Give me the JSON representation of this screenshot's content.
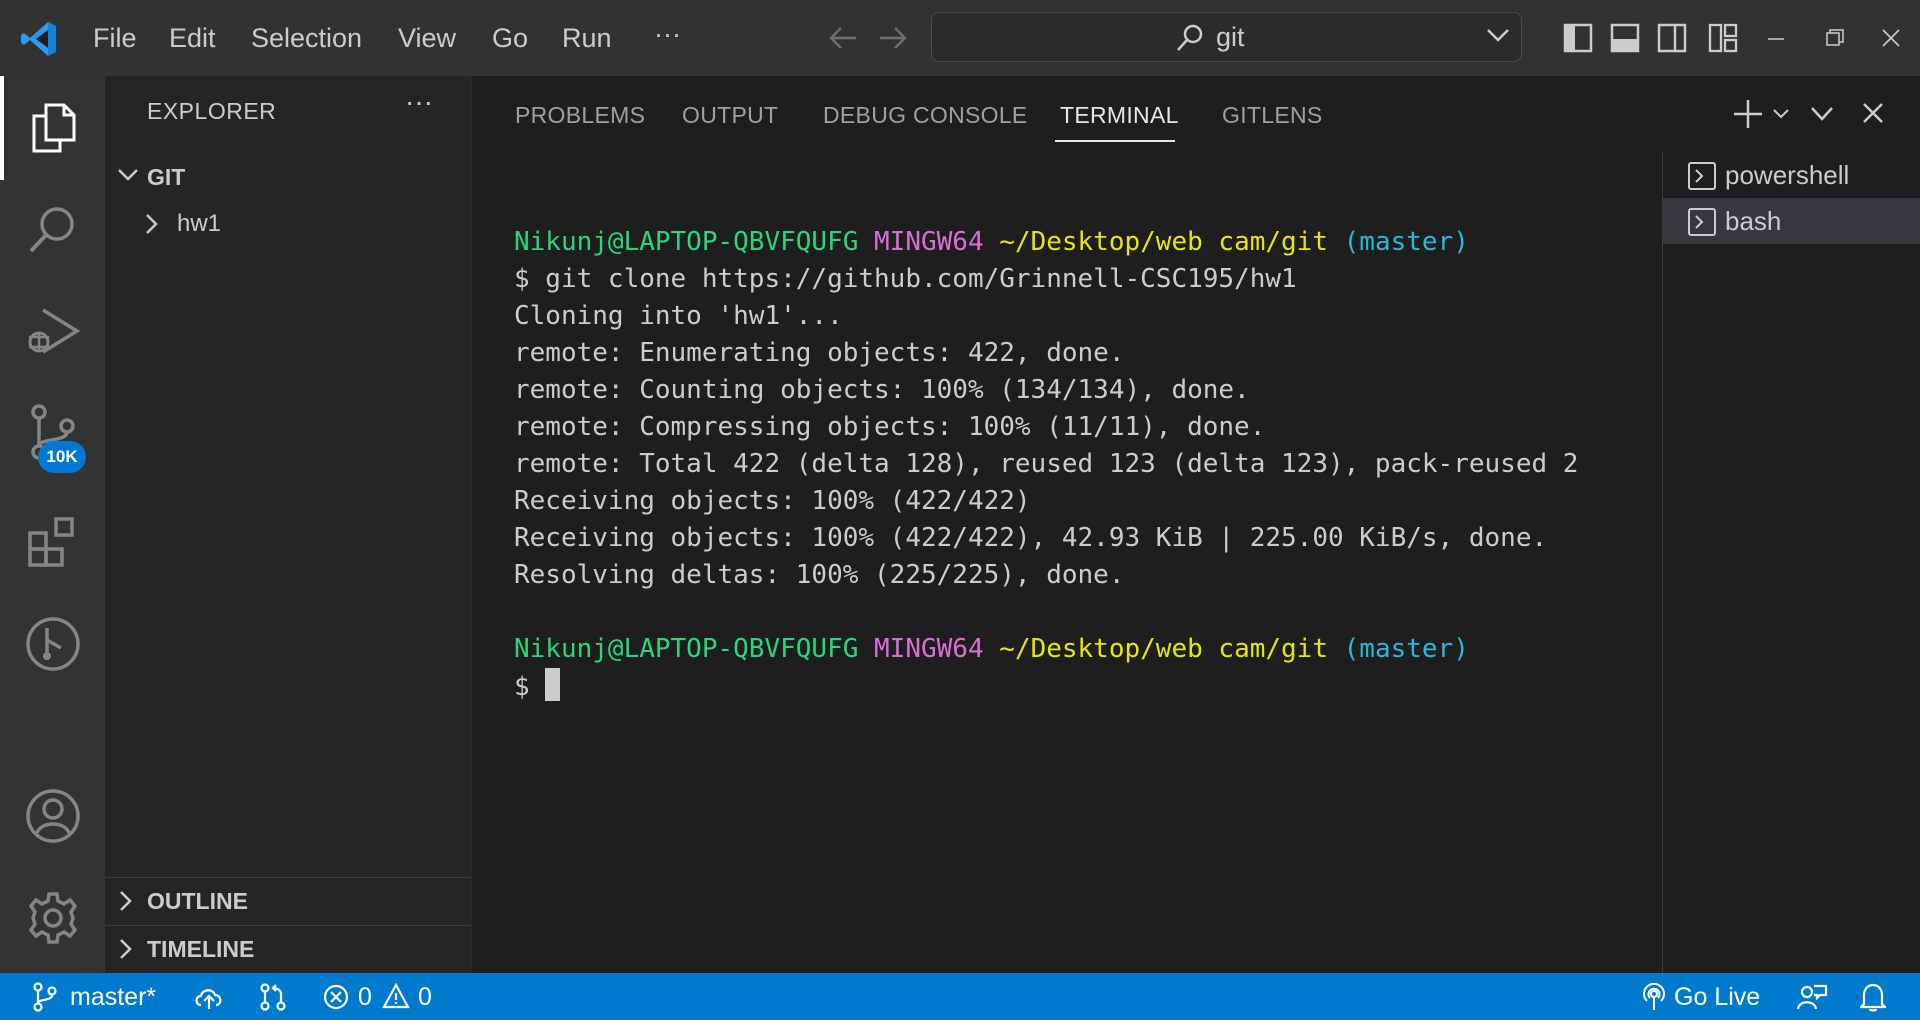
{
  "titlebar": {
    "menu": [
      "File",
      "Edit",
      "Selection",
      "View",
      "Go",
      "Run"
    ],
    "more_label": "···",
    "search_value": "git"
  },
  "activitybar": {
    "items": [
      "explorer-icon",
      "search-icon",
      "run-debug-icon",
      "source-control-icon",
      "extensions-icon",
      "gitlens-icon"
    ],
    "source_control_badge": "10K",
    "bottom": [
      "account-icon",
      "settings-gear-icon"
    ]
  },
  "sidebar": {
    "title": "EXPLORER",
    "more_label": "···",
    "root_folder": "GIT",
    "tree": [
      {
        "label": "hw1",
        "type": "folder",
        "expanded": false
      }
    ],
    "outline_label": "OUTLINE",
    "timeline_label": "TIMELINE"
  },
  "panel": {
    "tabs": [
      {
        "label": "PROBLEMS",
        "active": false
      },
      {
        "label": "OUTPUT",
        "active": false
      },
      {
        "label": "DEBUG CONSOLE",
        "active": false
      },
      {
        "label": "TERMINAL",
        "active": true
      },
      {
        "label": "GITLENS",
        "active": false
      }
    ],
    "terminal": {
      "prompt": {
        "user": "Nikunj@LAPTOP-QBVFQUFG",
        "env": "MINGW64",
        "path": "~/Desktop/web cam/git",
        "branch": "(master)"
      },
      "command": "$ git clone https://github.com/Grinnell-CSC195/hw1",
      "output": [
        "Cloning into 'hw1'...",
        "remote: Enumerating objects: 422, done.",
        "remote: Counting objects: 100% (134/134), done.",
        "remote: Compressing objects: 100% (11/11), done.",
        "remote: Total 422 (delta 128), reused 123 (delta 123), pack-reused 2",
        "Receiving objects: 100% (422/422)",
        "Receiving objects: 100% (422/422), 42.93 KiB | 225.00 KiB/s, done.",
        "Resolving deltas: 100% (225/225), done."
      ],
      "final_prompt_symbol": "$"
    },
    "terminal_list": [
      {
        "name": "powershell",
        "selected": false
      },
      {
        "name": "bash",
        "selected": true
      }
    ]
  },
  "statusbar": {
    "branch": "master*",
    "errors": "0",
    "warnings": "0",
    "go_live": "Go Live"
  },
  "colors": {
    "accent": "#007acc",
    "badge": "#0078d4",
    "prompt_user": "#2bd67b",
    "prompt_env": "#d670d6",
    "prompt_path": "#e5e510",
    "prompt_branch": "#29b8db"
  }
}
